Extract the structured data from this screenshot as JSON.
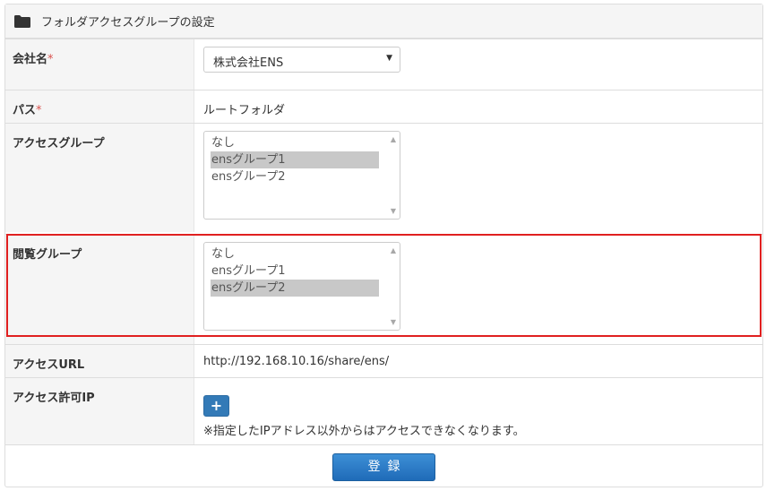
{
  "panel": {
    "title": "フォルダアクセスグループの設定",
    "icon": "folder-icon"
  },
  "form": {
    "company": {
      "label": "会社名",
      "required_mark": "*",
      "value": "株式会社ENS"
    },
    "path": {
      "label": "パス",
      "required_mark": "*",
      "value": "ルートフォルダ"
    },
    "access_group": {
      "label": "アクセスグループ",
      "options": [
        {
          "label": "なし",
          "selected": false
        },
        {
          "label": "ensグループ1",
          "selected": true
        },
        {
          "label": "ensグループ2",
          "selected": false
        }
      ]
    },
    "view_group": {
      "label": "閲覧グループ",
      "options": [
        {
          "label": "なし",
          "selected": false
        },
        {
          "label": "ensグループ1",
          "selected": false
        },
        {
          "label": "ensグループ2",
          "selected": true
        }
      ]
    },
    "access_url": {
      "label": "アクセスURL",
      "value": "http://192.168.10.16/share/ens/"
    },
    "allowed_ip": {
      "label": "アクセス許可IP",
      "add_label": "+",
      "note": "※指定したIPアドレス以外からはアクセスできなくなります。"
    },
    "submit_label": "登録"
  },
  "colors": {
    "primary": "#337ab7",
    "required": "#d9534f",
    "highlight": "#e02020"
  }
}
